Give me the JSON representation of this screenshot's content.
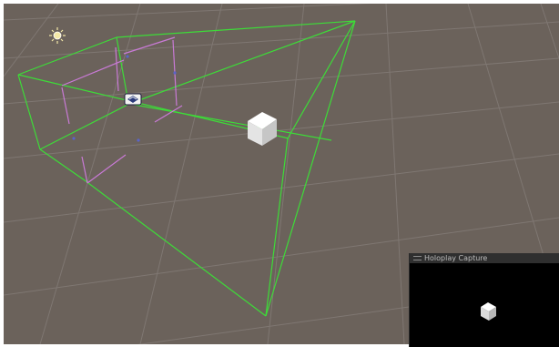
{
  "scene_view": {
    "background_color": "#6b625b",
    "grid_color": "#807873",
    "frustum_color": "#3ddc38",
    "clip_plane_color": "#c97ad6",
    "icons": {
      "light": "sun-icon",
      "camera": "holoplay-camera-icon",
      "cube": "cube-object"
    }
  },
  "capture_panel": {
    "title": "Holoplay Capture",
    "icon": "grip-icon",
    "background_color": "#000000"
  }
}
